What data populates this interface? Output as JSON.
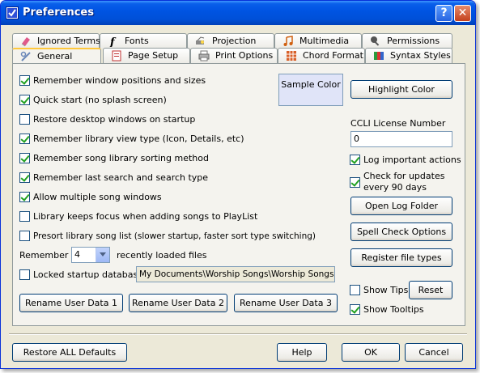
{
  "window": {
    "title": "Preferences"
  },
  "titlebar": {
    "help_glyph": "?",
    "close_glyph": "✕"
  },
  "tabs": {
    "row1": [
      {
        "label": "Ignored Terms",
        "icon": "eraser-icon"
      },
      {
        "label": "Fonts",
        "icon": "font-icon"
      },
      {
        "label": "Projection",
        "icon": "projector-icon"
      },
      {
        "label": "Multimedia",
        "icon": "music-note-icon"
      },
      {
        "label": "Permissions",
        "icon": "key-icon"
      }
    ],
    "row2": [
      {
        "label": "General",
        "icon": "general-icon",
        "active": true
      },
      {
        "label": "Page Setup",
        "icon": "page-setup-icon"
      },
      {
        "label": "Print Options",
        "icon": "printer-icon"
      },
      {
        "label": "Chord Format",
        "icon": "chord-format-icon"
      },
      {
        "label": "Syntax Styles",
        "icon": "syntax-styles-icon"
      }
    ]
  },
  "general": {
    "options": [
      {
        "label": "Remember window positions and sizes",
        "checked": true
      },
      {
        "label": "Quick start (no splash screen)",
        "checked": true
      },
      {
        "label": "Restore desktop windows on startup",
        "checked": false
      },
      {
        "label": "Remember library view type (Icon, Details, etc)",
        "checked": true
      },
      {
        "label": "Remember song library sorting method",
        "checked": true
      },
      {
        "label": "Remember last search and search type",
        "checked": true
      },
      {
        "label": "Allow multiple song windows",
        "checked": true
      },
      {
        "label": "Library keeps focus when adding songs to PlayList",
        "checked": false
      },
      {
        "label": "Presort library song list (slower startup, faster sort type switching)",
        "checked": false
      }
    ],
    "remember_label": "Remember",
    "remember_value": "4",
    "recent_label": "recently loaded files",
    "locked_db_label": "Locked startup database:",
    "locked_db_checked": false,
    "locked_db_path": "My Documents\\Worship Songs\\Worship Songs.sdb",
    "rename_buttons": [
      "Rename User Data 1",
      "Rename User Data 2",
      "Rename User Data 3"
    ],
    "sample_color_label": "Sample Color",
    "highlight_color_button": "Highlight Color",
    "ccli_label": "CCLI License Number",
    "ccli_value": "0",
    "log_actions_label": "Log important actions",
    "log_actions_checked": true,
    "check_updates_label_1": "Check for updates",
    "check_updates_label_2": "every 90 days",
    "check_updates_checked": true,
    "open_log_button": "Open Log Folder",
    "spell_check_button": "Spell Check Options",
    "register_button": "Register file types",
    "show_tips_label": "Show Tips",
    "show_tips_checked": false,
    "reset_button": "Reset",
    "show_tooltips_label": "Show Tooltips",
    "show_tooltips_checked": true
  },
  "footer": {
    "restore_defaults": "Restore ALL Defaults",
    "help": "Help",
    "ok": "OK",
    "cancel": "Cancel"
  },
  "colors": {
    "titlebar": "#0054E3",
    "dialog_bg": "#ECE9D8",
    "tab_panel_bg": "#F4F3EE",
    "active_tab_highlight": "#FFC83C",
    "checkmark": "#21A121",
    "sample_color": "#E0E4F8"
  }
}
